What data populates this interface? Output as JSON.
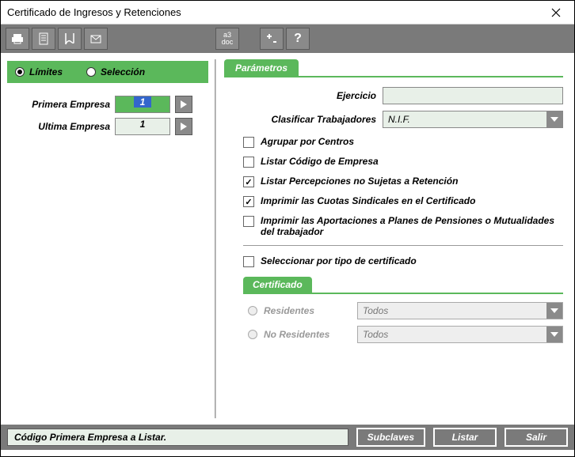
{
  "window": {
    "title": "Certificado de Ingresos y Retenciones"
  },
  "toolbar": {
    "a3doc_label": "a3\ndoc"
  },
  "mode": {
    "limites": "Límites",
    "seleccion": "Selección"
  },
  "empresa": {
    "primera_label": "Primera Empresa",
    "primera_value": "1",
    "ultima_label": "Ultima Empresa",
    "ultima_value": "1"
  },
  "params": {
    "tab": "Parámetros",
    "ejercicio_label": "Ejercicio",
    "ejercicio_value": "",
    "clasificar_label": "Clasificar Trabajadores",
    "clasificar_value": "N.I.F.",
    "checks": {
      "agrupar": "Agrupar por Centros",
      "listar_codigo": "Listar Código de Empresa",
      "listar_percepciones": "Listar Percepciones no Sujetas a Retención",
      "imprimir_cuotas": "Imprimir las Cuotas Sindicales en el Certificado",
      "imprimir_aportaciones": "Imprimir las Aportaciones a Planes de Pensiones o Mutualidades del trabajador",
      "seleccionar_tipo": "Seleccionar por tipo de certificado"
    }
  },
  "certificado": {
    "tab": "Certificado",
    "residentes_label": "Residentes",
    "residentes_value": "Todos",
    "no_residentes_label": "No Residentes",
    "no_residentes_value": "Todos"
  },
  "footer": {
    "status": "Código Primera Empresa a Listar.",
    "subclaves": "Subclaves",
    "listar": "Listar",
    "salir": "Salir"
  }
}
